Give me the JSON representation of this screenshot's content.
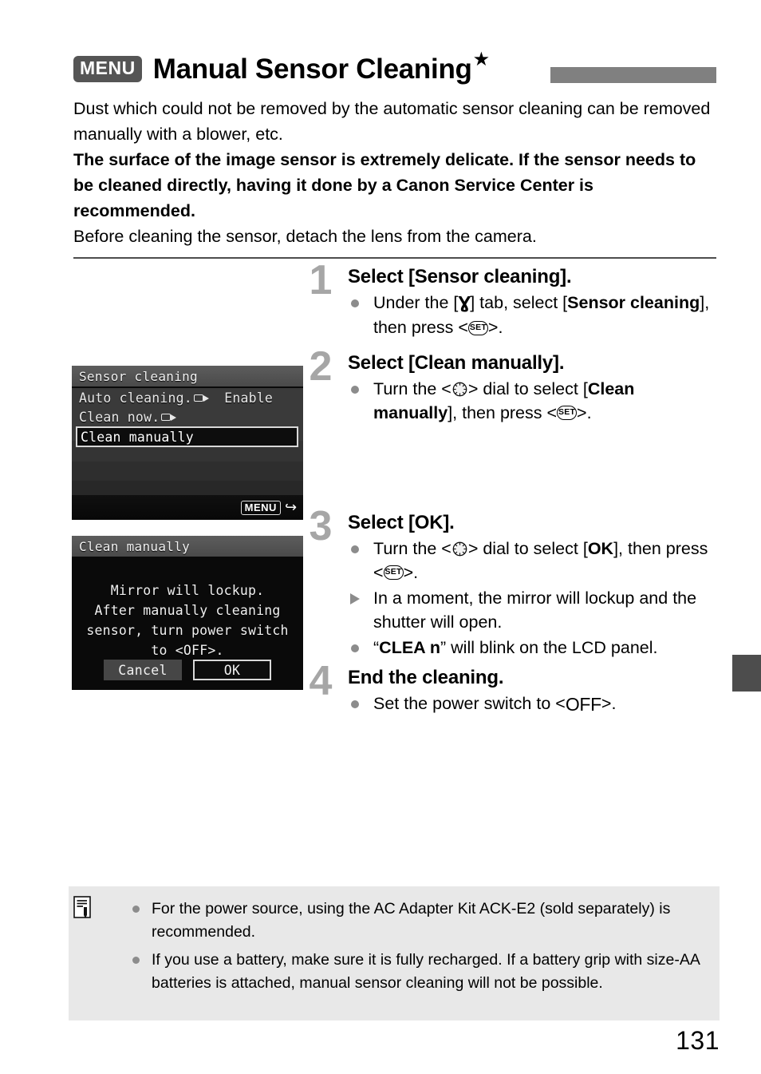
{
  "page": {
    "number": "131"
  },
  "header": {
    "menu_badge": "MENU",
    "title": "Manual Sensor Cleaning",
    "star": "★"
  },
  "intro": {
    "line1": "Dust which could not be removed by the automatic sensor cleaning can be removed manually with a blower, etc.",
    "line2_bold": "The surface of the image sensor is extremely delicate. If the sensor needs to be cleaned directly, having it done by a Canon Service Center is recommended.",
    "line3": "Before cleaning the sensor, detach the lens from the camera."
  },
  "screens": [
    {
      "id": "sensor-cleaning",
      "header": "Sensor cleaning",
      "items": [
        {
          "label": "Auto cleaning.",
          "icon": "sensor-icon",
          "value": "Enable",
          "selected": false
        },
        {
          "label": "Clean now.",
          "icon": "sensor-icon",
          "value": "",
          "selected": false
        },
        {
          "label": "Clean manually",
          "icon": "",
          "value": "",
          "selected": true
        }
      ],
      "footer_badge": "MENU",
      "footer_arrow": "↩"
    },
    {
      "id": "clean-manually",
      "header": "Clean manually",
      "message": "Mirror will lockup.\nAfter manually cleaning\nsensor, turn power switch\nto <OFF>.",
      "buttons": [
        {
          "label": "Cancel",
          "selected": false
        },
        {
          "label": "OK",
          "selected": true
        }
      ]
    }
  ],
  "steps": [
    {
      "number": "1",
      "title": "Select [Sensor cleaning].",
      "bullets": [
        {
          "marker": "dot",
          "parts": [
            {
              "t": "Under the [",
              "b": false
            },
            {
              "t": "set-up-tab-icon",
              "b": false,
              "icon": true
            },
            {
              "t": "] tab, select [",
              "b": false
            },
            {
              "t": "Sensor cleaning",
              "b": true
            },
            {
              "t": "], then press <",
              "b": false
            },
            {
              "t": "set-button-icon",
              "b": false,
              "icon": true
            },
            {
              "t": ">.",
              "b": false
            }
          ],
          "text": "Under the [♬] tab, select [Sensor cleaning], then press <SET>."
        }
      ]
    },
    {
      "number": "2",
      "title": "Select [Clean manually].",
      "bullets": [
        {
          "marker": "dot",
          "text": "Turn the <dial> dial to select [Clean manually], then press <SET>."
        }
      ]
    },
    {
      "number": "3",
      "title": "Select [OK].",
      "bullets": [
        {
          "marker": "dot",
          "text": "Turn the <dial> dial to select [OK], then press <SET>."
        },
        {
          "marker": "triangle",
          "text": "In a moment, the mirror will lockup and the shutter will open."
        },
        {
          "marker": "dot",
          "text": "“CLEA n” will blink on the LCD panel."
        }
      ]
    },
    {
      "number": "4",
      "title": "End the cleaning.",
      "bullets": [
        {
          "marker": "dot",
          "text": "Set the power switch to <OFF>."
        }
      ]
    }
  ],
  "step_text": {
    "s1_b1_p1": "Under the [",
    "s1_b1_p2": "] tab, select [",
    "s1_b1_p3": "Sensor cleaning",
    "s1_b1_p4": "], then press <",
    "s1_b1_p5": ">.",
    "s2_b1_p1": "Turn the <",
    "s2_b1_p2": "> dial to select [",
    "s2_b1_p3": "Clean manually",
    "s2_b1_p4": "], then press <",
    "s2_b1_p5": ">.",
    "s3_b1_p1": "Turn the <",
    "s3_b1_p2": "> dial to select [",
    "s3_b1_p3": "OK",
    "s3_b1_p4": "], then press <",
    "s3_b1_p5": ">.",
    "s3_b2": "In a moment, the mirror will lockup and the shutter will open.",
    "s3_b3_p1": "“",
    "s3_b3_p2": "CLEA n",
    "s3_b3_p3": "” will blink on the LCD panel.",
    "s4_b1_p1": "Set the power switch to <",
    "s4_b1_p2": "OFF",
    "s4_b1_p3": ">."
  },
  "icons": {
    "set_label": "SET",
    "off_label": "OFF",
    "setup_tab": "Ɣ"
  },
  "note": {
    "items": [
      "For the power source, using the AC Adapter Kit ACK-E2 (sold separately) is recommended.",
      "If you use a battery, make sure it is fully recharged. If a battery grip with size-AA batteries is attached, manual sensor cleaning will not be possible."
    ]
  },
  "colors": {
    "accent_gray": "#808080",
    "badge_gray": "#555555",
    "step_number": "#a6a6a6",
    "note_bg": "#e8e8e8",
    "edge_tab": "#4d4d4d"
  }
}
